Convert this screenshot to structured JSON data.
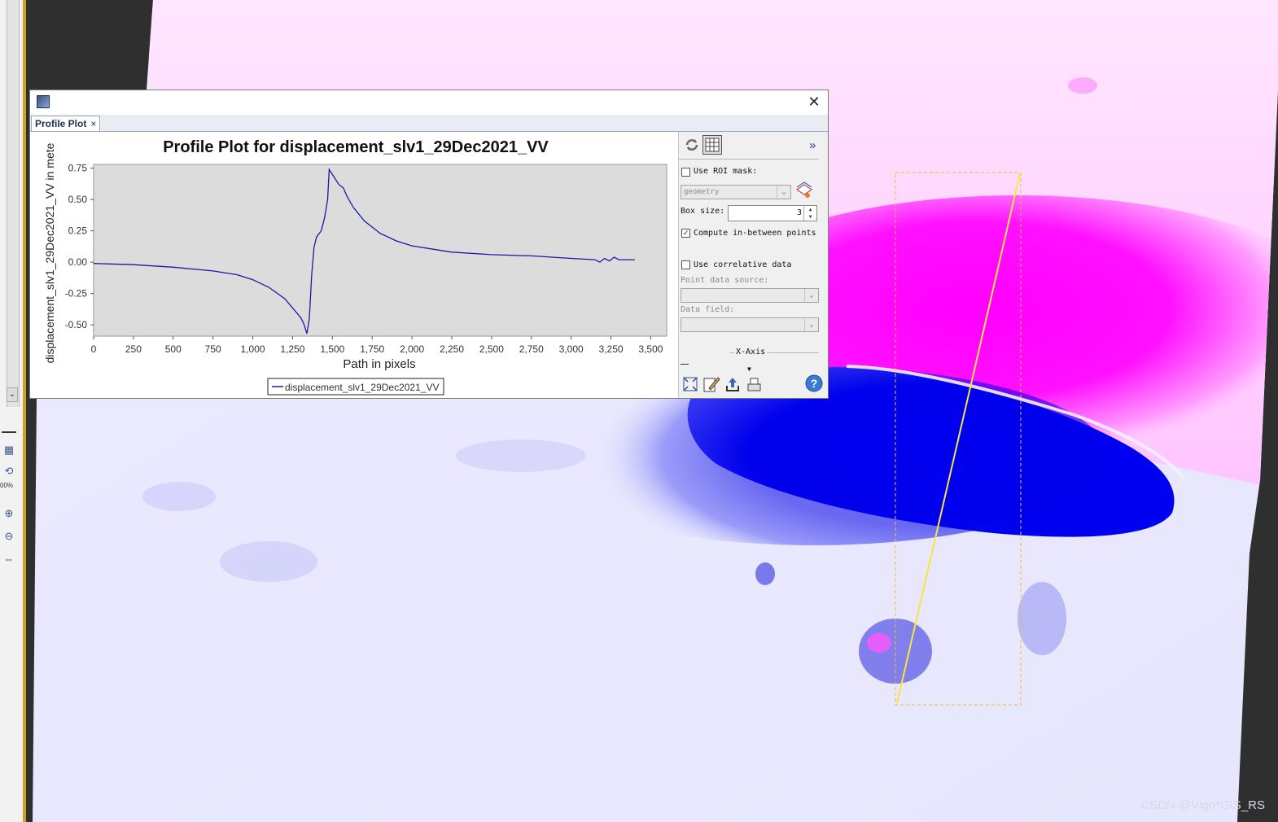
{
  "window": {
    "tab_label": "Profile Plot",
    "tab_close": "×",
    "close_glyph": "✕"
  },
  "plot": {
    "title": "Profile Plot for displacement_slv1_29Dec2021_VV",
    "legend_label": "displacement_slv1_29Dec2021_VV"
  },
  "side_panel": {
    "use_roi_label": "Use ROI mask:",
    "use_roi_checked": false,
    "roi_combo_value": "geometry",
    "box_size_label": "Box size:",
    "box_size_value": "3",
    "compute_between_label": "Compute in-between points",
    "compute_between_checked": true,
    "use_correlative_label": "Use correlative data",
    "use_correlative_checked": false,
    "point_data_source_label": "Point data source:",
    "data_field_label": "Data field:",
    "x_axis_label": "X-Axis",
    "expand_glyph": "»",
    "help_glyph": "?"
  },
  "chart_data": {
    "type": "line",
    "title": "Profile Plot for displacement_slv1_29Dec2021_VV",
    "xlabel": "Path in pixels",
    "ylabel": "displacement_slv1_29Dec2021_VV in mete",
    "xlim": [
      0,
      3600
    ],
    "ylim": [
      -0.59,
      0.78
    ],
    "xticks": [
      0,
      250,
      500,
      750,
      1000,
      1250,
      1500,
      1750,
      2000,
      2250,
      2500,
      2750,
      3000,
      3250,
      3500
    ],
    "xtick_labels": [
      "0",
      "250",
      "500",
      "750",
      "1,000",
      "1,250",
      "1,500",
      "1,750",
      "2,000",
      "2,250",
      "2,500",
      "2,750",
      "3,000",
      "3,250",
      "3,500"
    ],
    "yticks": [
      -0.5,
      -0.25,
      0,
      0.25,
      0.5,
      0.75
    ],
    "ytick_labels": [
      "-0.50",
      "-0.25",
      "0.00",
      "0.25",
      "0.50",
      "0.75"
    ],
    "grid": false,
    "legend_position": "bottom",
    "colors": {
      "line": "#1a1aa6",
      "plot_bg": "#dcdcdc"
    },
    "series": [
      {
        "name": "displacement_slv1_29Dec2021_VV",
        "points": [
          [
            0,
            -0.01
          ],
          [
            250,
            -0.02
          ],
          [
            500,
            -0.04
          ],
          [
            750,
            -0.07
          ],
          [
            900,
            -0.1
          ],
          [
            1000,
            -0.14
          ],
          [
            1100,
            -0.2
          ],
          [
            1200,
            -0.29
          ],
          [
            1260,
            -0.38
          ],
          [
            1300,
            -0.44
          ],
          [
            1320,
            -0.49
          ],
          [
            1340,
            -0.57
          ],
          [
            1355,
            -0.45
          ],
          [
            1370,
            -0.1
          ],
          [
            1385,
            0.12
          ],
          [
            1400,
            0.2
          ],
          [
            1430,
            0.25
          ],
          [
            1450,
            0.35
          ],
          [
            1470,
            0.5
          ],
          [
            1480,
            0.74
          ],
          [
            1510,
            0.68
          ],
          [
            1540,
            0.62
          ],
          [
            1570,
            0.59
          ],
          [
            1590,
            0.53
          ],
          [
            1630,
            0.44
          ],
          [
            1700,
            0.33
          ],
          [
            1800,
            0.23
          ],
          [
            1900,
            0.17
          ],
          [
            2000,
            0.13
          ],
          [
            2100,
            0.11
          ],
          [
            2250,
            0.08
          ],
          [
            2500,
            0.06
          ],
          [
            2750,
            0.05
          ],
          [
            3000,
            0.03
          ],
          [
            3150,
            0.02
          ],
          [
            3180,
            0.0
          ],
          [
            3210,
            0.03
          ],
          [
            3240,
            0.01
          ],
          [
            3270,
            0.04
          ],
          [
            3300,
            0.02
          ],
          [
            3400,
            0.02
          ]
        ]
      }
    ]
  },
  "map": {
    "watermark": "CSDN @Vigo*GIS_RS",
    "colors": {
      "bg": "#2f2f2f",
      "magenta": "#ff00ff",
      "pink_light": "#ffd9ff",
      "blue_dark": "#0000ee",
      "blue_light": "#eaeaff",
      "profile_line": "#f5e642",
      "roi_box": "#f0c020"
    }
  },
  "left_toolbar": {
    "zoom_label": "00%",
    "scroll_down": "⌄"
  }
}
